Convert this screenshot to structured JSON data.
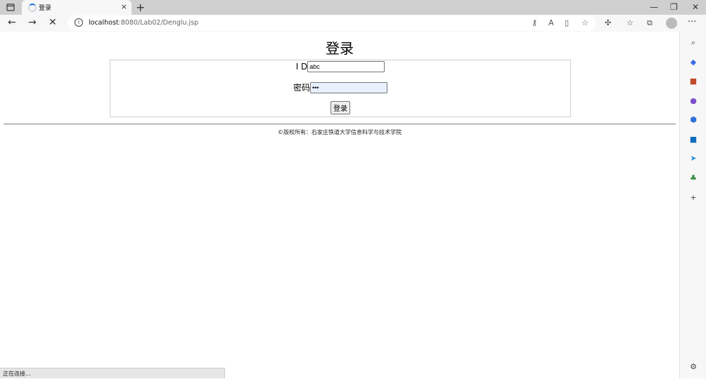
{
  "tab": {
    "title": "登录",
    "close": "×",
    "new_tab": "+"
  },
  "window": {
    "minimize": "—",
    "restore": "❐",
    "close": "✕"
  },
  "nav": {
    "back": "←",
    "forward": "→",
    "stop": "✕"
  },
  "address": {
    "host": "localhost",
    "path": ":8080/Lab02/Denglu.jsp",
    "info": "i"
  },
  "page": {
    "title": "登录",
    "id_label": "I D",
    "id_value": "abc",
    "password_label": "密码",
    "password_value": "•••",
    "login_button": "登录",
    "copyright": "©版权所有：石家庄铁道大学信息科学与技术学院"
  },
  "status_bar": {
    "text": "正在连接..."
  },
  "sidebar": {
    "icons": [
      "search-icon",
      "tag-icon",
      "briefcase-icon",
      "person-icon",
      "office-icon",
      "outlook-icon",
      "send-icon",
      "tree-icon",
      "add-icon",
      "settings-icon"
    ]
  },
  "colors": {
    "tab_strip": "#cfcfcf",
    "toolbar": "#f7f7f7",
    "focused_input": "#e8f0fe"
  }
}
